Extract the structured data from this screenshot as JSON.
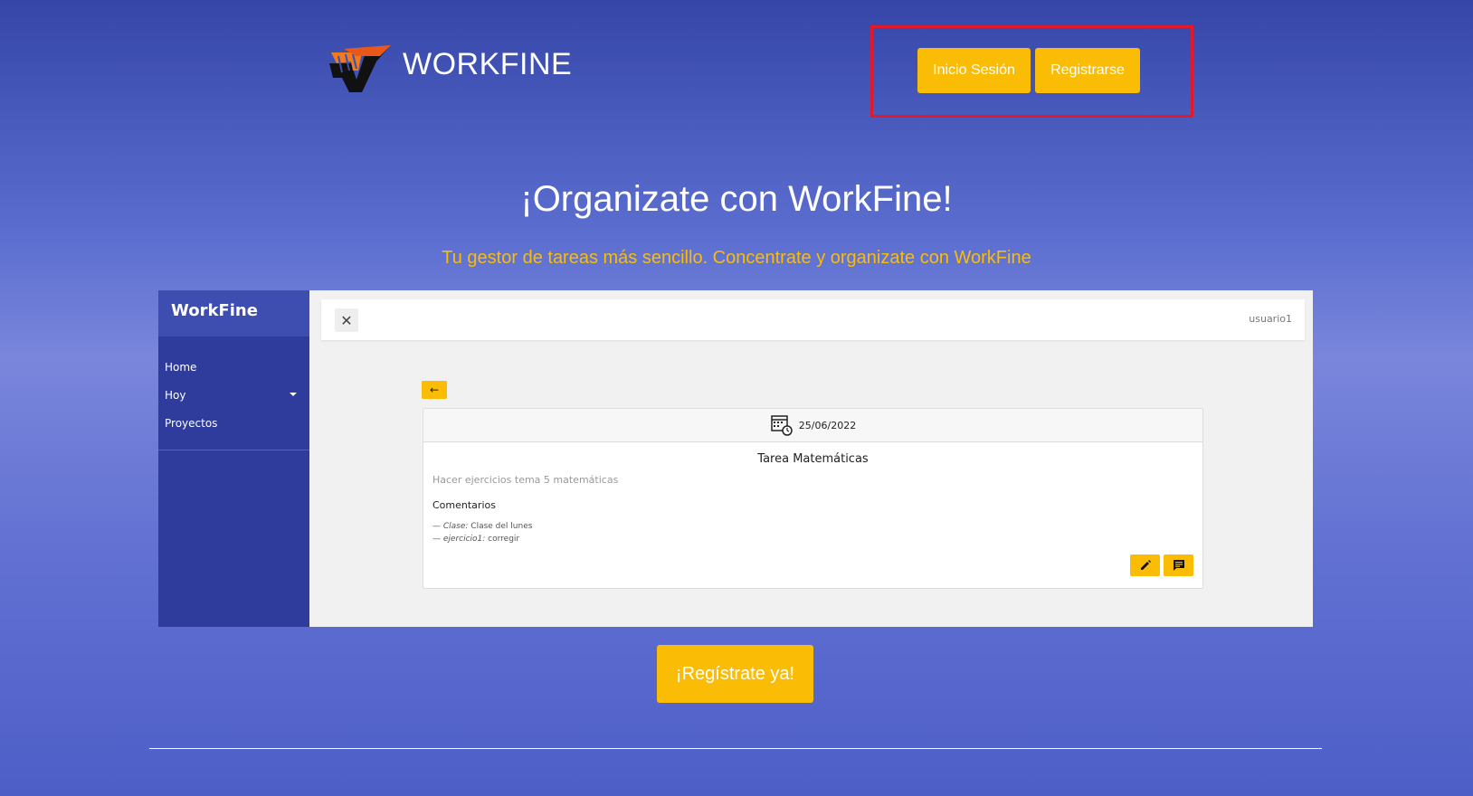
{
  "header": {
    "brand": "WORKFINE",
    "login_label": "Inicio Sesión",
    "register_label": "Registrarse"
  },
  "hero": {
    "title": "¡Organizate con WorkFine!",
    "subtitle": "Tu gestor de tareas más sencillo. Concentrate y organizate con WorkFine",
    "cta_label": "¡Regístrate ya!"
  },
  "preview": {
    "sidebar_title": "WorkFine",
    "nav": [
      "Home",
      "Hoy",
      "Proyectos"
    ],
    "user": "usuario1",
    "back_arrow": "←",
    "close_glyph": "✕",
    "task": {
      "date": "25/06/2022",
      "title": "Tarea Matemáticas",
      "description": "Hacer ejercicios tema 5 matemáticas",
      "comments_heading": "Comentarios",
      "comments": [
        {
          "prefix": "— ",
          "author": "Clase:",
          "text": " Clase del lunes"
        },
        {
          "prefix": "— ",
          "author": "ejercicio1:",
          "text": " corregir"
        }
      ]
    }
  },
  "colors": {
    "accent": "#fbbc05",
    "sidebar": "#303c9c",
    "highlight": "#e3192b"
  },
  "icons": [
    "logo-icon",
    "close-icon",
    "back-arrow-icon",
    "calendar-icon",
    "edit-icon",
    "comment-icon",
    "caret-down-icon"
  ]
}
